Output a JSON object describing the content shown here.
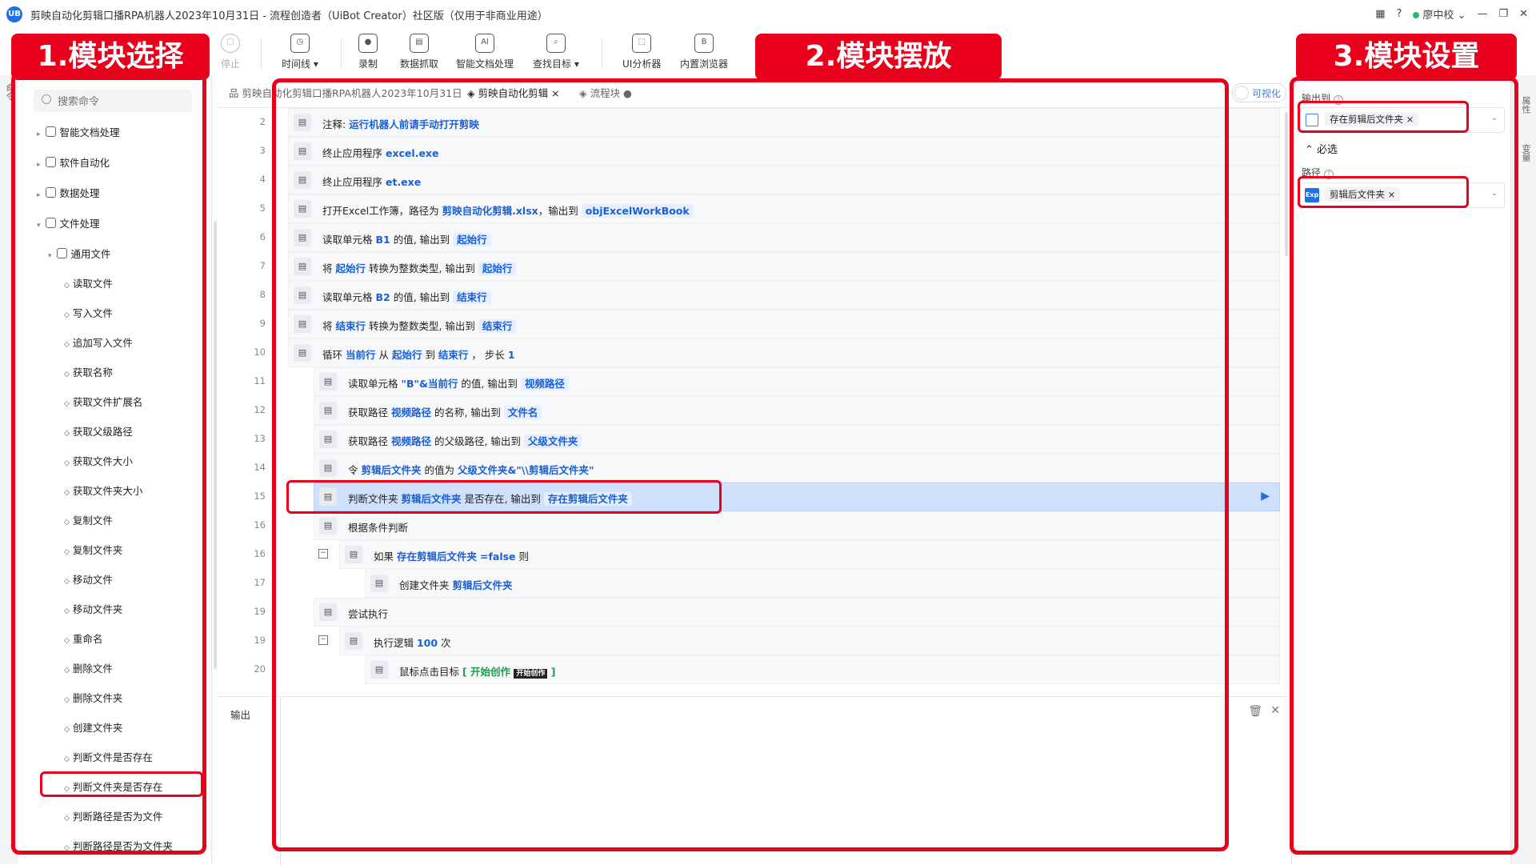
{
  "window": {
    "logo_text": "UB",
    "title": "剪映自动化剪辑口播RPA机器人2023年10月31日 - 流程创造者（UiBot Creator）社区版（仅用于非商业用途）",
    "help": "?",
    "user": "廖中校",
    "controls": [
      "—",
      "❐",
      "✕"
    ]
  },
  "toolbar": [
    {
      "label": "停止",
      "icon": "stop-icon",
      "glyph": "▢",
      "disabled": true
    },
    {
      "label": "时间线 ▾",
      "icon": "clock-icon",
      "glyph": "◷"
    },
    {
      "label": "录制",
      "icon": "record-icon",
      "glyph": "●"
    },
    {
      "label": "数据抓取",
      "icon": "data-grab-icon",
      "glyph": "▤"
    },
    {
      "label": "智能文档处理",
      "icon": "ai-doc-icon",
      "glyph": "AI"
    },
    {
      "label": "查找目标 ▾",
      "icon": "find-target-icon",
      "glyph": "⌕"
    },
    {
      "label": "UI分析器",
      "icon": "ui-analyzer-icon",
      "glyph": "⬚"
    },
    {
      "label": "内置浏览器",
      "icon": "browser-icon",
      "glyph": "B"
    }
  ],
  "left": {
    "search_placeholder": "搜索命令",
    "categories": [
      {
        "label": "智能文档处理",
        "arrow": "▸"
      },
      {
        "label": "软件自动化",
        "arrow": "▸"
      },
      {
        "label": "数据处理",
        "arrow": "▸"
      },
      {
        "label": "文件处理",
        "arrow": "▾"
      }
    ],
    "subcategory": {
      "label": "通用文件",
      "arrow": "▾"
    },
    "leaves": [
      "读取文件",
      "写入文件",
      "追加写入文件",
      "获取名称",
      "获取文件扩展名",
      "获取父级路径",
      "获取文件大小",
      "获取文件夹大小",
      "复制文件",
      "复制文件夹",
      "移动文件",
      "移动文件夹",
      "重命名",
      "删除文件",
      "删除文件夹",
      "创建文件夹",
      "判断文件是否存在",
      "判断文件夹是否存在",
      "判断路径是否为文件",
      "判断路径是否为文件夹"
    ]
  },
  "tabs": [
    {
      "label": "品 剪映自动化剪辑口播RPA机器人2023年10月31日",
      "active": false
    },
    {
      "label": "◈ 剪映自动化剪辑 ×",
      "active": true
    },
    {
      "label": "◈ 流程块 ●",
      "active": false
    }
  ],
  "visualize_toggle": "可视化",
  "flow_rows": [
    {
      "n": "2",
      "indent": 0,
      "html": "注释: <span class='kw'>运行机器人前请手动打开剪映</span>",
      "hatch": true
    },
    {
      "n": "3",
      "indent": 0,
      "html": "终止应用程序 <span class='kw'>excel.exe</span>"
    },
    {
      "n": "4",
      "indent": 0,
      "html": "终止应用程序 <span class='kw'>et.exe</span>"
    },
    {
      "n": "5",
      "indent": 0,
      "html": "打开Excel工作簿，路径为 <span class='kw'>剪映自动化剪辑.xlsx</span>，输出到 <span class='var'>objExcelWorkBook</span>"
    },
    {
      "n": "6",
      "indent": 0,
      "html": "读取单元格 <span class='kw'>B1</span> 的值, 输出到 <span class='var'>起始行</span>"
    },
    {
      "n": "7",
      "indent": 0,
      "html": "将 <span class='kw'>起始行</span> 转换为整数类型, 输出到 <span class='var'>起始行</span>"
    },
    {
      "n": "8",
      "indent": 0,
      "html": "读取单元格 <span class='kw'>B2</span> 的值, 输出到 <span class='var'>结束行</span>"
    },
    {
      "n": "9",
      "indent": 0,
      "html": "将 <span class='kw'>结束行</span> 转换为整数类型, 输出到 <span class='var'>结束行</span>"
    },
    {
      "n": "10",
      "indent": 0,
      "html": "循环 <span class='kw'>当前行</span> 从 <span class='kw'>起始行</span> 到 <span class='kw'>结束行</span> ， 步长 <span class='kw'>1</span>"
    },
    {
      "n": "11",
      "indent": 1,
      "html": "读取单元格 <span class='kw'>\"B\"&当前行</span> 的值, 输出到 <span class='var'>视频路径</span>"
    },
    {
      "n": "12",
      "indent": 1,
      "html": "获取路径 <span class='kw'>视频路径</span> 的名称, 输出到 <span class='var'>文件名</span>"
    },
    {
      "n": "13",
      "indent": 1,
      "html": "获取路径 <span class='kw'>视频路径</span> 的父级路径, 输出到 <span class='var'>父级文件夹</span>"
    },
    {
      "n": "14",
      "indent": 1,
      "html": "令 <span class='kw'>剪辑后文件夹</span> 的值为 <span class='kw'>父级文件夹&\"\\\\剪辑后文件夹\"</span>"
    },
    {
      "n": "15",
      "indent": 1,
      "html": "判断文件夹 <span class='kw'>剪辑后文件夹</span> 是否存在, 输出到 <span class='var'>存在剪辑后文件夹</span>",
      "selected": true
    },
    {
      "n": "16",
      "indent": 1,
      "html": "根据条件判断"
    },
    {
      "n": "16",
      "indent": 2,
      "html": "如果 <span class='kw'>存在剪辑后文件夹</span> <span class='kw'>=false</span> 则",
      "minus": true
    },
    {
      "n": "17",
      "indent": 3,
      "html": "创建文件夹 <span class='kw'>剪辑后文件夹</span>"
    },
    {
      "n": "19",
      "indent": 1,
      "html": "尝试执行"
    },
    {
      "n": "19",
      "indent": 2,
      "html": "执行逻辑 <span class='kw'>100</span> 次",
      "minus": true
    },
    {
      "n": "20",
      "indent": 3,
      "html": "鼠标点击目标 <span class='grn'>[ 开始创作 <span class='tagblk'>开始创作</span> ]</span>"
    }
  ],
  "output": {
    "label": "输出",
    "trash": "🗑",
    "close": "✕"
  },
  "right": {
    "output_label": "输出到",
    "output_value": "存在剪辑后文件夹 ×",
    "section": "⌃ 必选",
    "path_label": "路径",
    "path_badge": "Exp",
    "path_value": "剪辑后文件夹 ×",
    "caret": "⌄"
  },
  "side_tabs": {
    "left": "命令",
    "right_top": "属性",
    "right_bottom": "变量"
  },
  "annotations": {
    "banner1": "1.模块选择",
    "banner2": "2.模块摆放",
    "banner3": "3.模块设置"
  },
  "colors": {
    "annotation_red": "#e8001c",
    "accent_blue": "#1a5fd6",
    "selection": "#cfe0fb"
  }
}
